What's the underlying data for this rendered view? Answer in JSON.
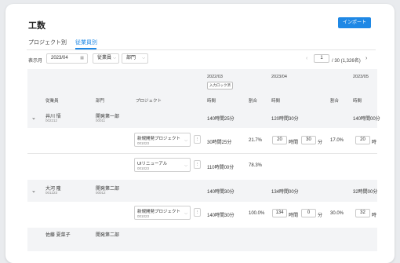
{
  "header": {
    "title": "工数",
    "import_label": "インポート"
  },
  "tabs": [
    {
      "label": "プロジェクト別"
    },
    {
      "label": "従業員別"
    }
  ],
  "filters": {
    "period_label": "表示月",
    "period_value": "2023/04",
    "employee_label": "従業員",
    "dept_label": "部門"
  },
  "pagination": {
    "current": "1",
    "total": "/ 30 (1,326名)"
  },
  "columns": {
    "employee": "従業員",
    "dept": "部門",
    "project": "プロジェクト",
    "months": [
      {
        "label": "2022/03",
        "lock_badge": "入力ロック済",
        "time": "時間",
        "ratio": "割合"
      },
      {
        "label": "2023/04",
        "time": "時間",
        "ratio": "割合"
      },
      {
        "label": "2023/05",
        "time": "時間"
      }
    ]
  },
  "rows": [
    {
      "name": "井川 悟",
      "emp_id": "002212",
      "dept": "開発第一部",
      "dept_id": "00011",
      "m1_total": "140時間25分",
      "m2_total": "120時間30分",
      "m3_total": "140時間00分",
      "projects": [
        {
          "name": "新規開発プロジェクト",
          "code": "001023",
          "m1_time": "30時間25分",
          "m1_ratio": "21.7%",
          "m2_hours": "20",
          "m2_mins": "30",
          "m2_ratio": "17.0%",
          "m3_hours": "20"
        },
        {
          "name": "UIリニューアル",
          "code": "001023",
          "m1_time": "110時間00分",
          "m1_ratio": "78.3%"
        }
      ]
    },
    {
      "name": "大河 隆",
      "emp_id": "001223",
      "dept": "開発第二部",
      "dept_id": "00012",
      "m1_total": "140時間30分",
      "m2_total": "134時間00分",
      "m3_total": "32時間00分",
      "projects": [
        {
          "name": "新規開発プロジェクト",
          "code": "001023",
          "m1_time": "140時間30分",
          "m1_ratio": "100.0%",
          "m2_hours": "134",
          "m2_mins": "0",
          "m2_ratio": "30.0%",
          "m3_hours": "32"
        }
      ]
    },
    {
      "name": "佐藤 夏菜子",
      "dept": "開発第二部"
    }
  ],
  "units": {
    "hour": "時間",
    "minute": "分",
    "hour_short": "時"
  },
  "kebab": "⋮"
}
